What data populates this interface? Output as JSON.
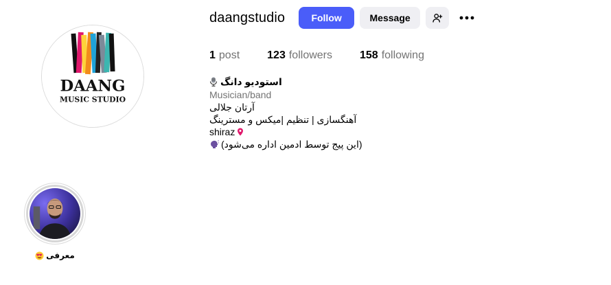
{
  "profile": {
    "username": "daangstudio",
    "follow_label": "Follow",
    "message_label": "Message",
    "logo_text_line1": "DAANG",
    "logo_text_line2": "MUSIC STUDIO",
    "brand_blue": "#4a5df9"
  },
  "stats": [
    {
      "count": "1",
      "label": "post"
    },
    {
      "count": "123",
      "label": "followers"
    },
    {
      "count": "158",
      "label": "following"
    }
  ],
  "bio": {
    "name": "استودیو دانگ",
    "category": "Musician/band",
    "line1": "آرتان جلالی",
    "line2": "آهنگسازی | تنظیم |میکس و مسترینگ",
    "location": "shiraz",
    "note": "(این پیج توسط ادمین اداره می‌شود)"
  },
  "highlights": [
    {
      "label": "معرفی",
      "icon": "heart-eyes-emoji"
    }
  ],
  "icons": {
    "add_user": "add-user-icon",
    "more": "more-options-icon",
    "mic": "microphone-icon",
    "pin": "location-pin-icon",
    "speaker": "speaking-head-icon"
  }
}
